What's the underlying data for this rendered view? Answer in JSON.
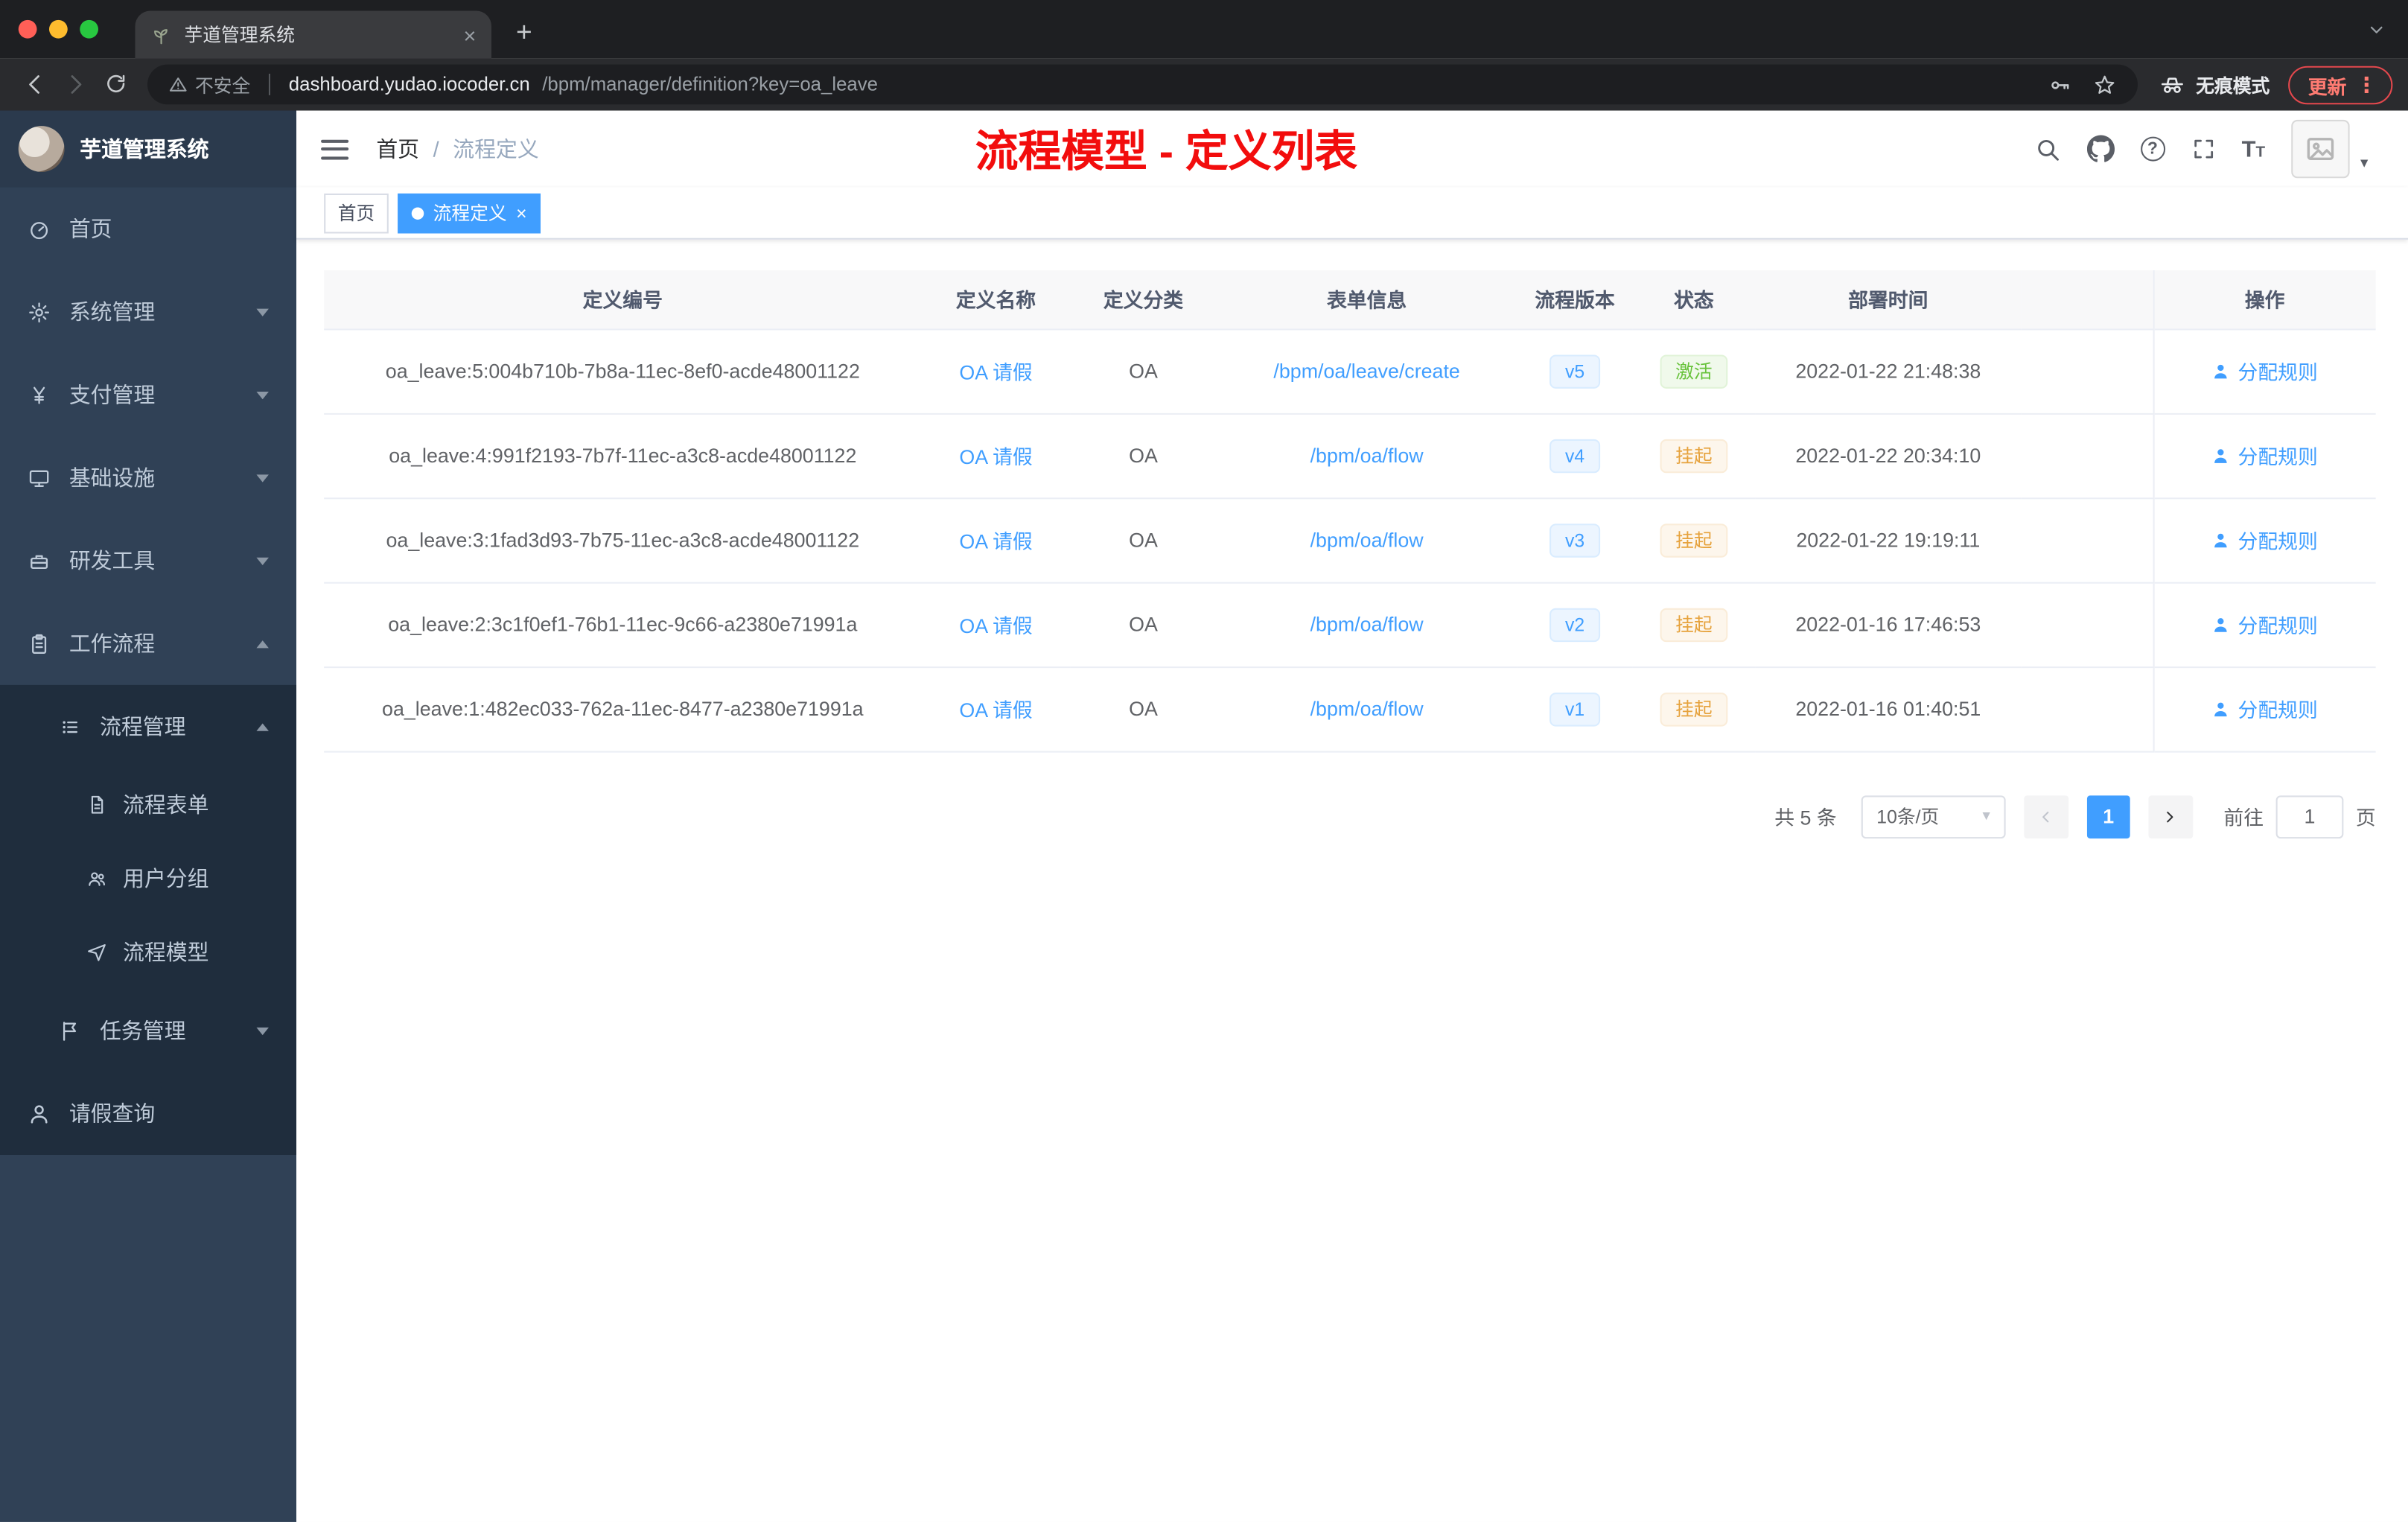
{
  "browser": {
    "tab_title": "芋道管理系统",
    "url_security": "不安全",
    "url_host": "dashboard.yudao.iocoder.cn",
    "url_path": "/bpm/manager/definition?key=oa_leave",
    "incognito_label": "无痕模式",
    "update_label": "更新"
  },
  "icons": {
    "close": "×",
    "plus": "+",
    "kebab": "⋮",
    "caret_down": "▾",
    "question": "?",
    "star": "☆",
    "font_big": "T",
    "font_small": "T"
  },
  "sidebar": {
    "logo_title": "芋道管理系统",
    "items": [
      {
        "label": "首页"
      },
      {
        "label": "系统管理"
      },
      {
        "label": "支付管理"
      },
      {
        "label": "基础设施"
      },
      {
        "label": "研发工具"
      },
      {
        "label": "工作流程"
      }
    ],
    "submenu": {
      "label": "流程管理",
      "children": [
        {
          "label": "流程表单"
        },
        {
          "label": "用户分组"
        },
        {
          "label": "流程模型"
        }
      ]
    },
    "more": [
      {
        "label": "任务管理"
      },
      {
        "label": "请假查询"
      }
    ]
  },
  "navbar": {
    "breadcrumb": [
      "首页",
      "流程定义"
    ],
    "breadcrumb_sep": "/",
    "annotation": "流程模型 - 定义列表"
  },
  "tags": {
    "home": "首页",
    "active": "流程定义"
  },
  "table": {
    "headers": [
      "定义编号",
      "定义名称",
      "定义分类",
      "表单信息",
      "流程版本",
      "状态",
      "部署时间",
      "操作"
    ],
    "rows": [
      {
        "id": "oa_leave:5:004b710b-7b8a-11ec-8ef0-acde48001122",
        "name": "OA 请假",
        "category": "OA",
        "form": "/bpm/oa/leave/create",
        "version": "v5",
        "status": "激活",
        "time": "2022-01-22 21:48:38",
        "action": "分配规则"
      },
      {
        "id": "oa_leave:4:991f2193-7b7f-11ec-a3c8-acde48001122",
        "name": "OA 请假",
        "category": "OA",
        "form": "/bpm/oa/flow",
        "version": "v4",
        "status": "挂起",
        "time": "2022-01-22 20:34:10",
        "action": "分配规则"
      },
      {
        "id": "oa_leave:3:1fad3d93-7b75-11ec-a3c8-acde48001122",
        "name": "OA 请假",
        "category": "OA",
        "form": "/bpm/oa/flow",
        "version": "v3",
        "status": "挂起",
        "time": "2022-01-22 19:19:11",
        "action": "分配规则"
      },
      {
        "id": "oa_leave:2:3c1f0ef1-76b1-11ec-9c66-a2380e71991a",
        "name": "OA 请假",
        "category": "OA",
        "form": "/bpm/oa/flow",
        "version": "v2",
        "status": "挂起",
        "time": "2022-01-16 17:46:53",
        "action": "分配规则"
      },
      {
        "id": "oa_leave:1:482ec033-762a-11ec-8477-a2380e71991a",
        "name": "OA 请假",
        "category": "OA",
        "form": "/bpm/oa/flow",
        "version": "v1",
        "status": "挂起",
        "time": "2022-01-16 01:40:51",
        "action": "分配规则"
      }
    ]
  },
  "pagination": {
    "total": "共 5 条",
    "page_size": "10条/页",
    "current": "1",
    "goto_label": "前往",
    "goto_value": "1",
    "page_label": "页"
  },
  "colors": {
    "primary": "#409eff",
    "success": "#67c23a",
    "warning": "#e6a23c",
    "annotation": "#f20d0d",
    "sidebar_bg": "#304156",
    "sidebar_sub_bg": "#1f2d3d"
  }
}
